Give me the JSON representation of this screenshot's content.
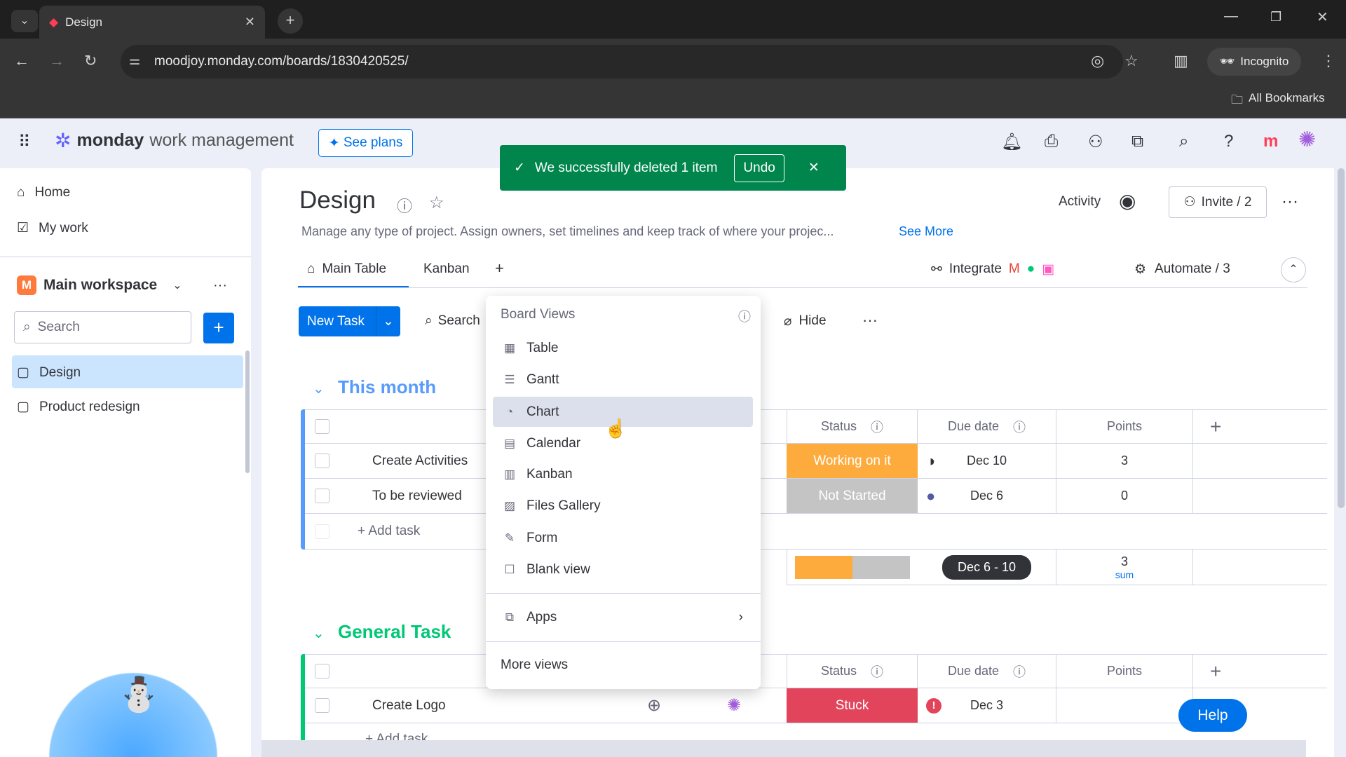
{
  "browser": {
    "tab_title": "Design",
    "url": "moodjoy.monday.com/boards/1830420525/",
    "incognito": "Incognito",
    "bookmarks": "All Bookmarks"
  },
  "app": {
    "brand": "monday",
    "product": "work management",
    "see_plans": "See plans"
  },
  "toast": {
    "message": "We successfully deleted 1 item",
    "undo": "Undo"
  },
  "sidebar": {
    "home": "Home",
    "my_work": "My work",
    "workspace": "Main workspace",
    "workspace_initial": "M",
    "search_placeholder": "Search",
    "boards": [
      "Design",
      "Product redesign"
    ]
  },
  "board": {
    "title": "Design",
    "description": "Manage any type of project. Assign owners, set timelines and keep track of where your projec...",
    "see_more": "See More",
    "activity": "Activity",
    "invite": "Invite / 2",
    "tabs": [
      "Main Table",
      "Kanban"
    ],
    "integrate": "Integrate",
    "automate": "Automate / 3",
    "new_task": "New Task",
    "search": "Search",
    "hide": "Hide"
  },
  "dropdown": {
    "header": "Board Views",
    "items": [
      "Table",
      "Gantt",
      "Chart",
      "Calendar",
      "Kanban",
      "Files Gallery",
      "Form",
      "Blank view"
    ],
    "apps": "Apps",
    "more": "More views"
  },
  "groups": [
    {
      "title": "This month",
      "color": "#579bfc",
      "columns": [
        "Status",
        "Due date",
        "Points"
      ],
      "rows": [
        {
          "name": "Create Activities",
          "status": "Working on it",
          "status_color": "#fdab3d",
          "due": "Dec 10",
          "points": "3"
        },
        {
          "name": "To be reviewed",
          "status": "Not Started",
          "status_color": "#c4c4c4",
          "due": "Dec 6",
          "points": "0"
        }
      ],
      "add_task": "+ Add task",
      "summary": {
        "date_range": "Dec 6 - 10",
        "points": "3",
        "points_label": "sum",
        "status_split": [
          0.5,
          0.5
        ]
      }
    },
    {
      "title": "General Task",
      "color": "#00c875",
      "columns": [
        "Status",
        "Due date",
        "Points"
      ],
      "rows": [
        {
          "name": "Create Logo",
          "status": "Stuck",
          "status_color": "#e2445c",
          "due": "Dec 3",
          "points": ""
        }
      ],
      "add_task": "+ Add task"
    }
  ],
  "help": "Help"
}
